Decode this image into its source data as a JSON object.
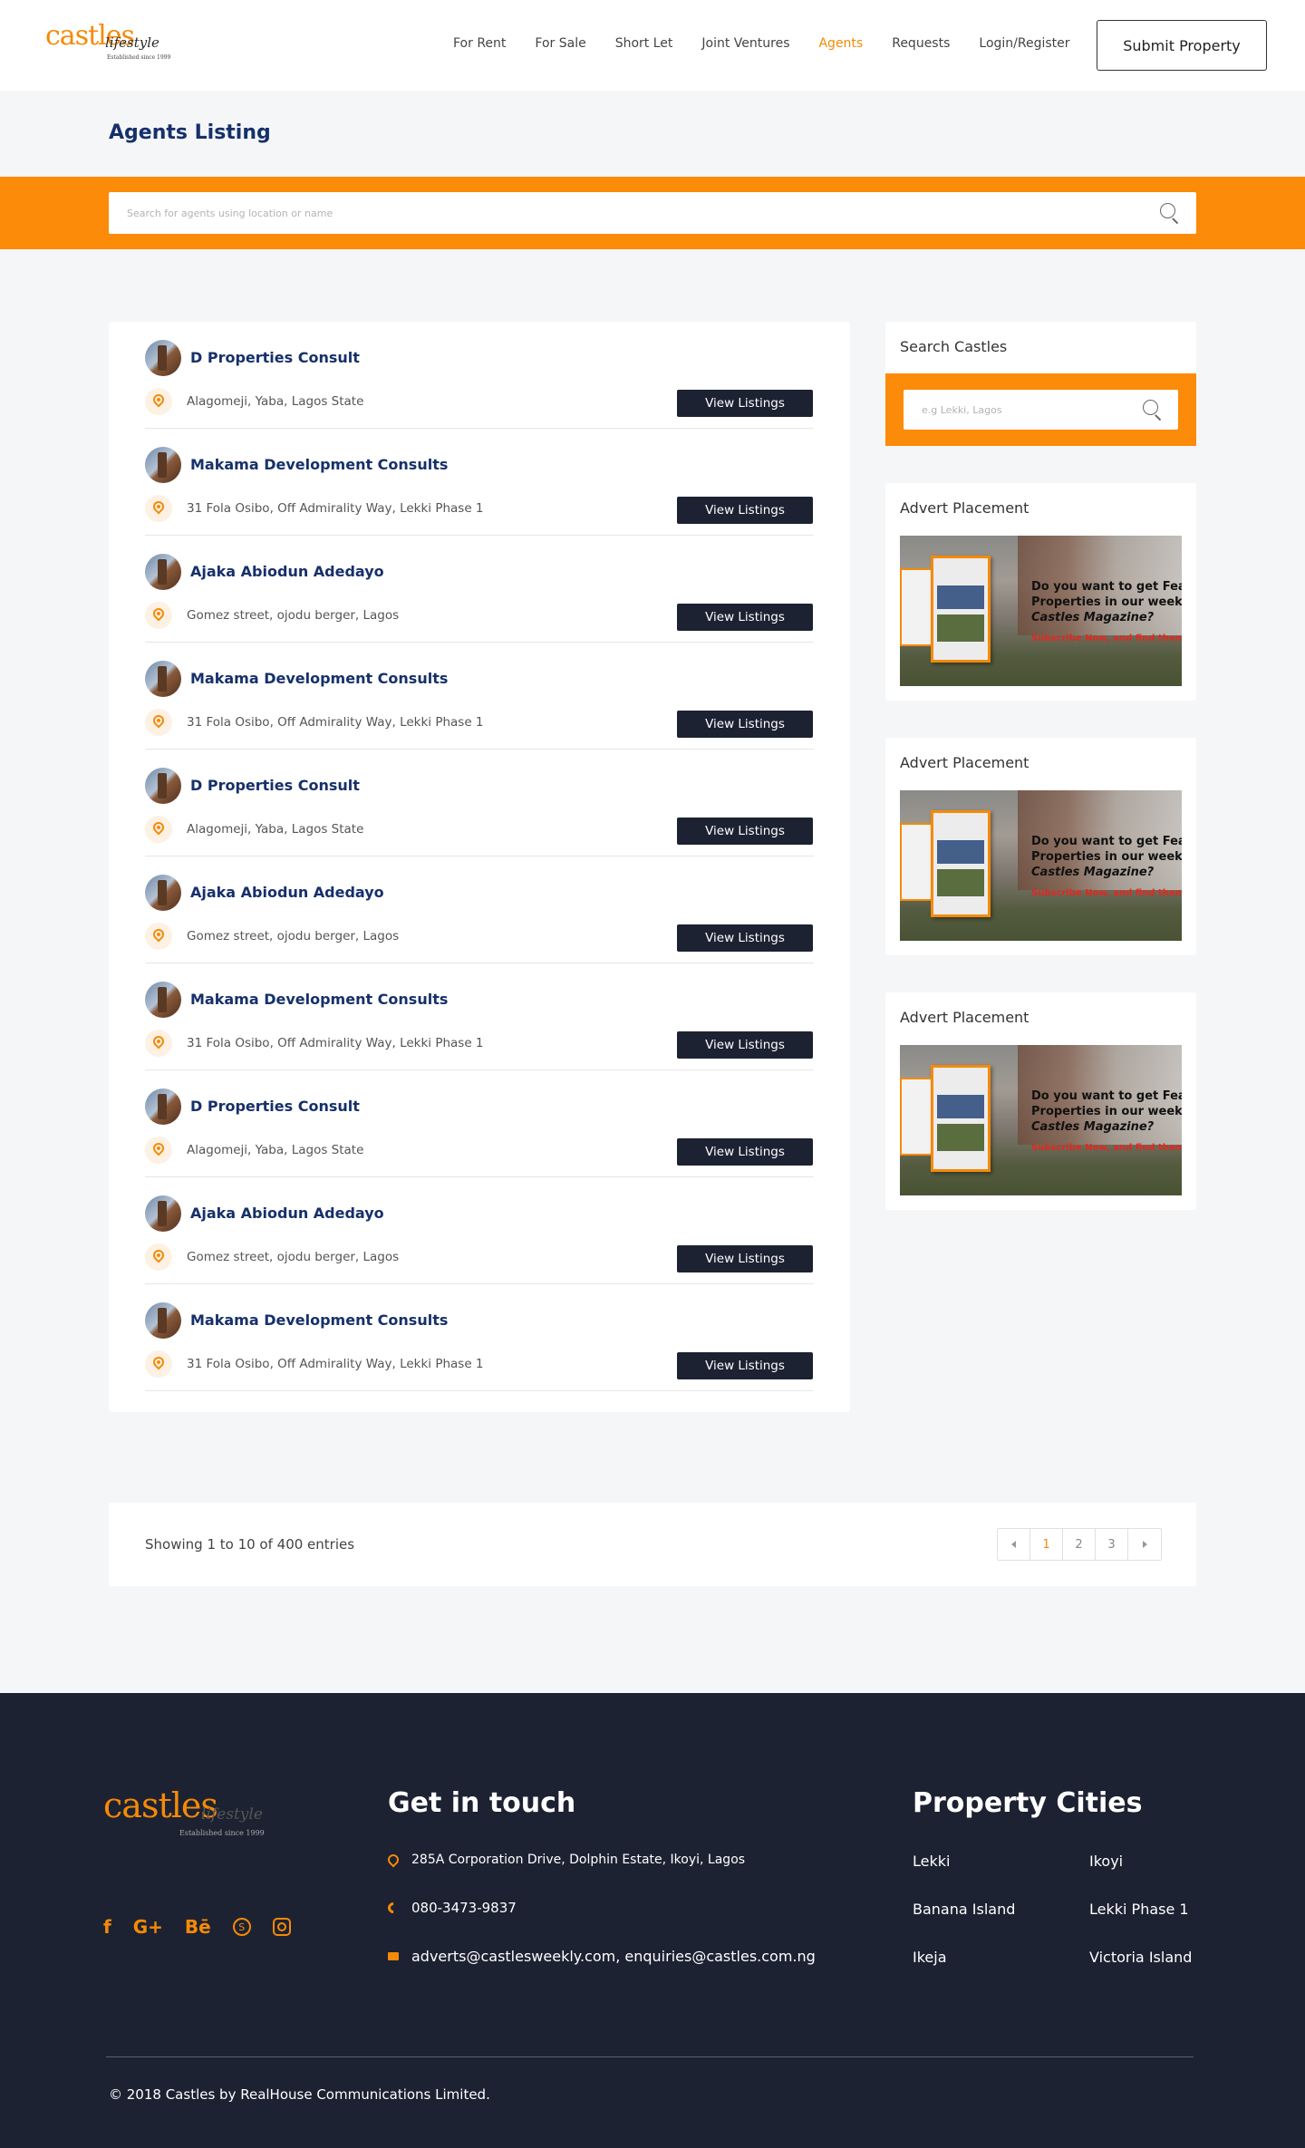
{
  "header": {
    "logo_text": "castles",
    "logo_script": "lifestyle",
    "logo_tagline": "Established since 1999",
    "nav": [
      "For Rent",
      "For Sale",
      "Short Let",
      "Joint Ventures",
      "Agents",
      "Requests",
      "Login/Register"
    ],
    "active_nav": "Agents",
    "submit_label": "Submit Property"
  },
  "page": {
    "title": "Agents Listing",
    "search_placeholder": "Search for agents using location or name"
  },
  "agents": [
    {
      "name": "D Properties Consult",
      "address": "Alagomeji, Yaba, Lagos State",
      "button": "View Listings"
    },
    {
      "name": "Makama Development Consults",
      "address": "31 Fola Osibo, Off Admirality Way, Lekki Phase 1",
      "button": "View Listings"
    },
    {
      "name": "Ajaka Abiodun Adedayo",
      "address": "Gomez street, ojodu berger, Lagos",
      "button": "View Listings"
    },
    {
      "name": "Makama Development Consults",
      "address": "31 Fola Osibo, Off Admirality Way, Lekki Phase 1",
      "button": "View Listings"
    },
    {
      "name": "D Properties Consult",
      "address": "Alagomeji, Yaba, Lagos State",
      "button": "View Listings"
    },
    {
      "name": "Ajaka Abiodun Adedayo",
      "address": "Gomez street, ojodu berger, Lagos",
      "button": "View Listings"
    },
    {
      "name": "Makama Development Consults",
      "address": "31 Fola Osibo, Off Admirality Way, Lekki Phase 1",
      "button": "View Listings"
    },
    {
      "name": "D Properties Consult",
      "address": "Alagomeji, Yaba, Lagos State",
      "button": "View Listings"
    },
    {
      "name": "Ajaka Abiodun Adedayo",
      "address": "Gomez street, ojodu berger, Lagos",
      "button": "View Listings"
    },
    {
      "name": "Makama Development Consults",
      "address": "31 Fola Osibo, Off Admirality Way, Lekki Phase 1",
      "button": "View Listings"
    }
  ],
  "sidebar": {
    "search_title": "Search Castles",
    "search_placeholder": "e.g Lekki, Lagos",
    "adverts": [
      {
        "title": "Advert Placement",
        "line1": "Do you want to get Feat",
        "line2": "Properties in our weekly",
        "line3": "Castles Magazine?",
        "cta": "Subscribe Now, and find them i"
      },
      {
        "title": "Advert Placement",
        "line1": "Do you want to get Feat",
        "line2": "Properties in our weekly",
        "line3": "Castles Magazine?",
        "cta": "Subscribe Now, and find them i"
      },
      {
        "title": "Advert Placement",
        "line1": "Do you want to get Feat",
        "line2": "Properties in our weekly",
        "line3": "Castles Magazine?",
        "cta": "Subscribe Now, and find them i"
      }
    ]
  },
  "pagination": {
    "entries_text": "Showing 1 to 10 of 400 entries",
    "pages": [
      "1",
      "2",
      "3"
    ],
    "current": "1"
  },
  "footer": {
    "logo_text": "castles",
    "logo_script": "lifestyle",
    "logo_tagline": "Established since 1999",
    "social_icons": [
      "facebook-icon",
      "google-plus-icon",
      "behance-icon",
      "skype-icon",
      "instagram-icon"
    ],
    "contact_heading": "Get in touch",
    "address": "285A Corporation Drive, Dolphin Estate, Ikoyi, Lagos",
    "phone": "080-3473-9837",
    "email": "adverts@castlesweekly.com, enquiries@castles.com.ng",
    "cities_heading": "Property Cities",
    "cities": [
      "Lekki",
      "Ikoyi",
      "Banana Island",
      "Lekki Phase 1",
      "Ikeja",
      "Victoria Island"
    ],
    "copyright": "© 2018 Castles by RealHouse Communications Limited."
  },
  "colors": {
    "accent": "#fb8b09",
    "navy": "#16306a",
    "dark": "#1d2232"
  }
}
